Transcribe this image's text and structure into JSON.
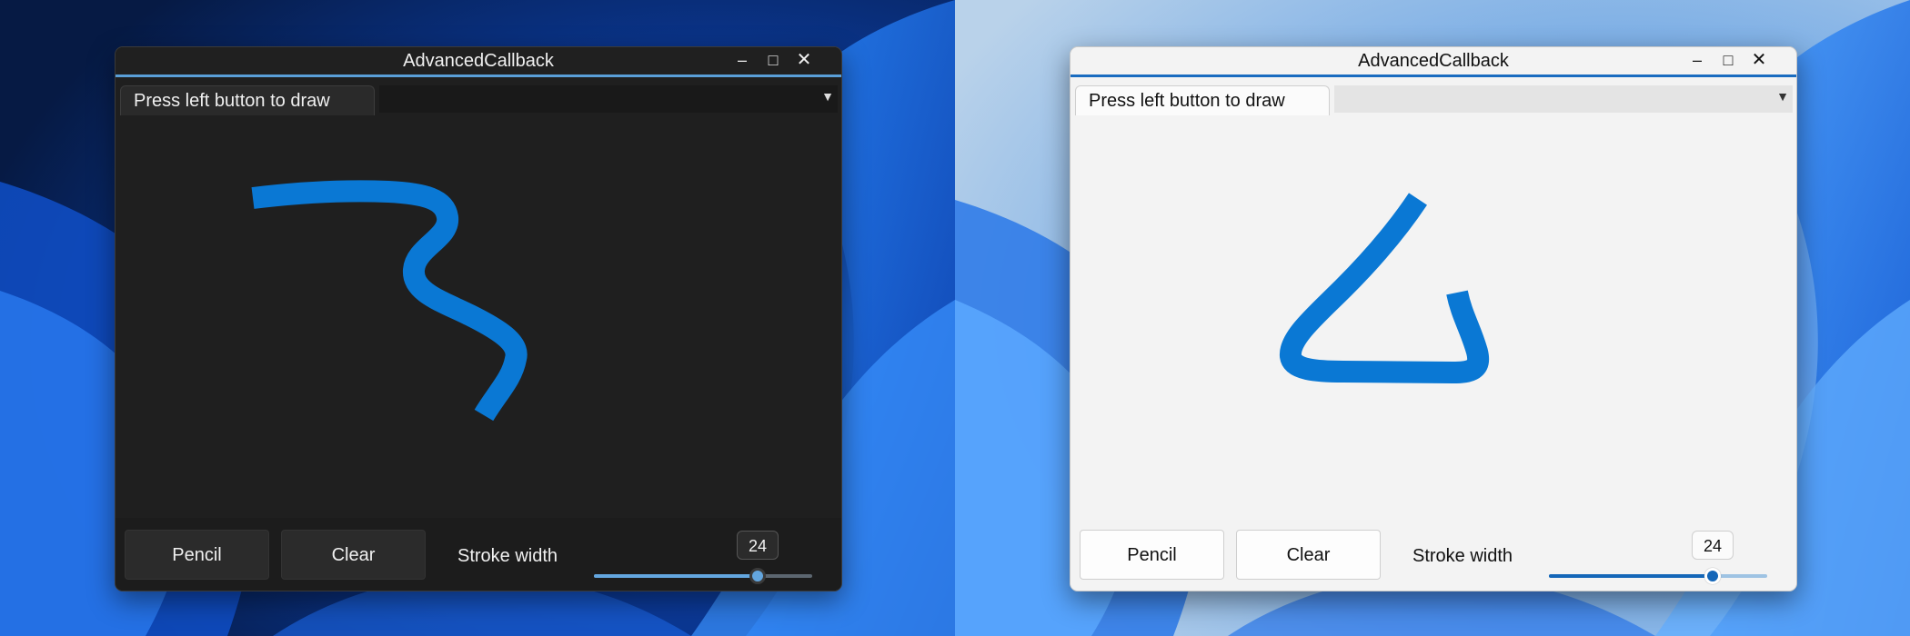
{
  "colors": {
    "stroke": "#0a78d4",
    "dark_bg": "#1f1f1f",
    "light_bg": "#f3f3f3",
    "accent_dark": "#5a9fd8",
    "accent_light": "#1a6cc0"
  },
  "windows": [
    {
      "theme": "dark",
      "title": "AdvancedCallback",
      "caption_buttons": {
        "minimize": "–",
        "maximize": "□",
        "close": "✕"
      },
      "tab_label": "Press left button to draw",
      "tab_menu_icon": "▼",
      "toolbar": {
        "pencil_label": "Pencil",
        "clear_label": "Clear",
        "stroke_width_label": "Stroke width",
        "stroke_width_value": "24",
        "slider_fraction": 0.75
      }
    },
    {
      "theme": "light",
      "title": "AdvancedCallback",
      "caption_buttons": {
        "minimize": "–",
        "maximize": "□",
        "close": "✕"
      },
      "tab_label": "Press left button to draw",
      "tab_menu_icon": "▼",
      "toolbar": {
        "pencil_label": "Pencil",
        "clear_label": "Clear",
        "stroke_width_label": "Stroke width",
        "stroke_width_value": "24",
        "slider_fraction": 0.75
      }
    }
  ]
}
